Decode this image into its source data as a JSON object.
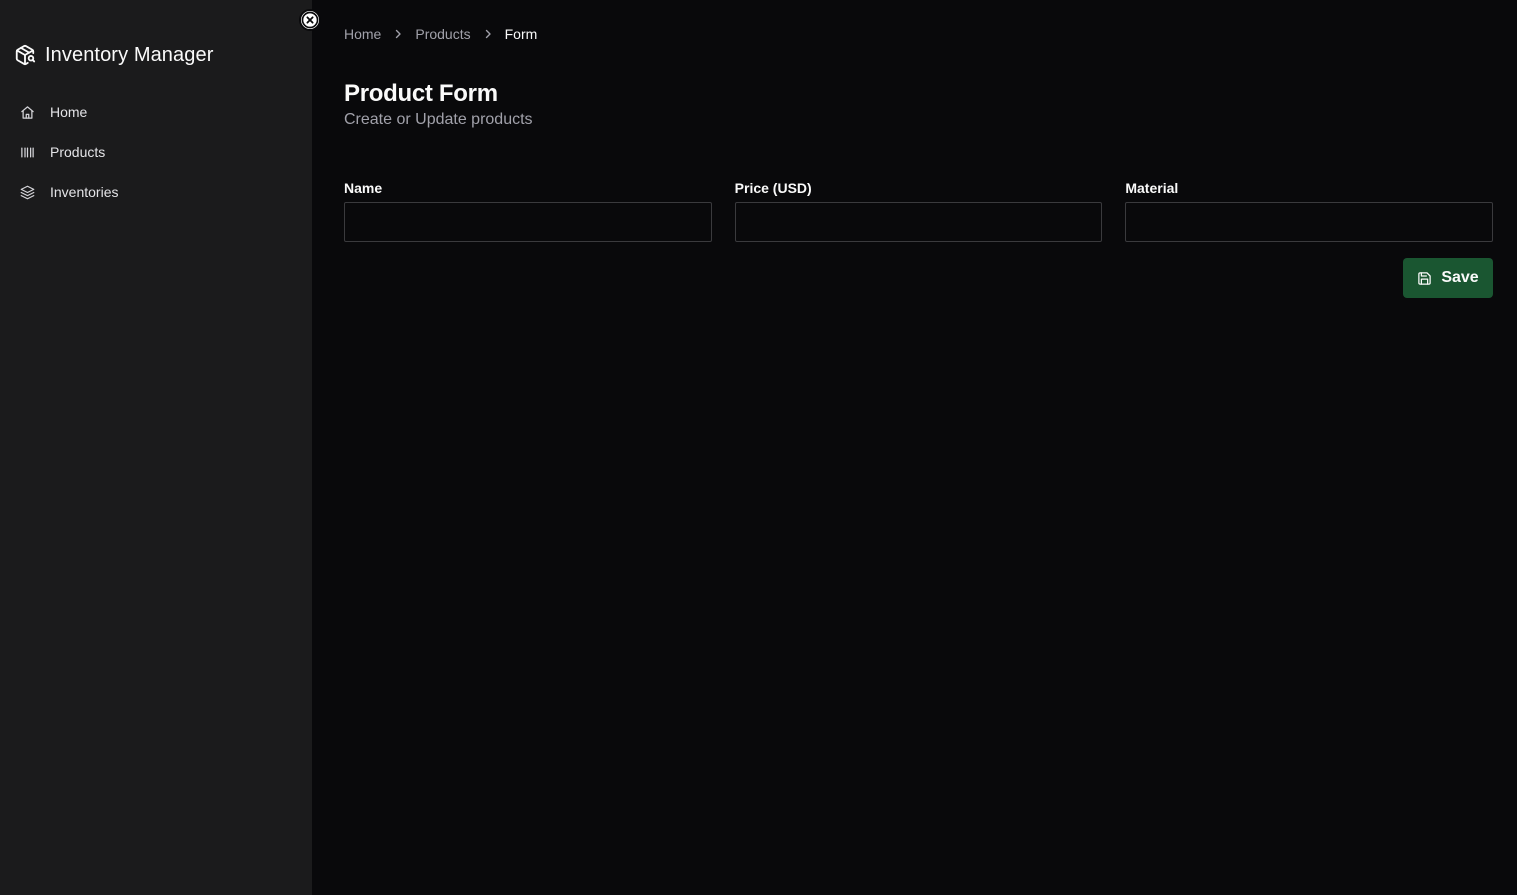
{
  "app": {
    "title": "Inventory Manager"
  },
  "sidebar": {
    "items": [
      {
        "label": "Home",
        "icon": "home-icon"
      },
      {
        "label": "Products",
        "icon": "barcode-icon"
      },
      {
        "label": "Inventories",
        "icon": "layers-icon"
      }
    ]
  },
  "breadcrumb": {
    "items": [
      "Home",
      "Products",
      "Form"
    ]
  },
  "page": {
    "title": "Product Form",
    "subtitle": "Create or Update products"
  },
  "form": {
    "fields": [
      {
        "label": "Name",
        "value": ""
      },
      {
        "label": "Price (USD)",
        "value": ""
      },
      {
        "label": "Material",
        "value": ""
      }
    ],
    "save_label": "Save"
  },
  "colors": {
    "background": "#09090b",
    "sidebar": "#1b1b1c",
    "accent": "#1a5631",
    "muted_text": "#a1a1aa"
  }
}
